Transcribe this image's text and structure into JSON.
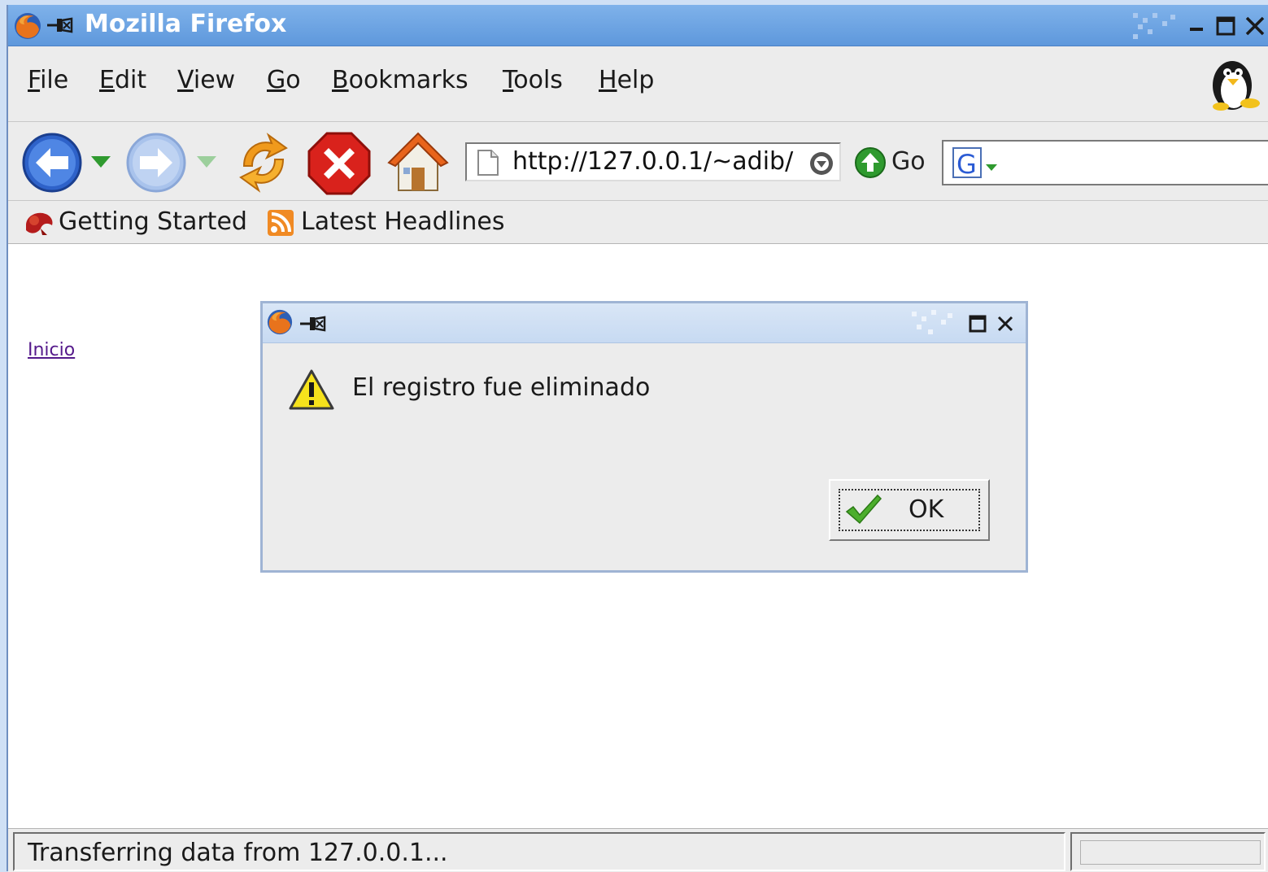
{
  "window": {
    "title": "Mozilla Firefox"
  },
  "menu": {
    "items": [
      {
        "mnemonic": "F",
        "rest": "ile"
      },
      {
        "mnemonic": "E",
        "rest": "dit"
      },
      {
        "mnemonic": "V",
        "rest": "iew"
      },
      {
        "mnemonic": "G",
        "rest": "o"
      },
      {
        "mnemonic": "B",
        "rest": "ookmarks"
      },
      {
        "mnemonic": "T",
        "rest": "ools"
      },
      {
        "mnemonic": "H",
        "rest": "elp"
      }
    ]
  },
  "toolbar": {
    "url": "http://127.0.0.1/~adib/",
    "go_label": "Go",
    "search_value": ""
  },
  "bookmarks": {
    "items": [
      {
        "label": "Getting Started",
        "icon": "firefox-bookmark-icon"
      },
      {
        "label": "Latest Headlines",
        "icon": "rss-feed-icon"
      }
    ]
  },
  "content": {
    "link_label": "Inicio"
  },
  "dialog": {
    "message": "El registro fue eliminado",
    "ok_label": "OK",
    "icon": "warning-icon"
  },
  "status": {
    "text": "Transferring data from 127.0.0.1..."
  },
  "colors": {
    "titlebar": "#6fa6e6",
    "dialog_titlebar": "#cfdff4",
    "link_visited": "#551a8b"
  }
}
